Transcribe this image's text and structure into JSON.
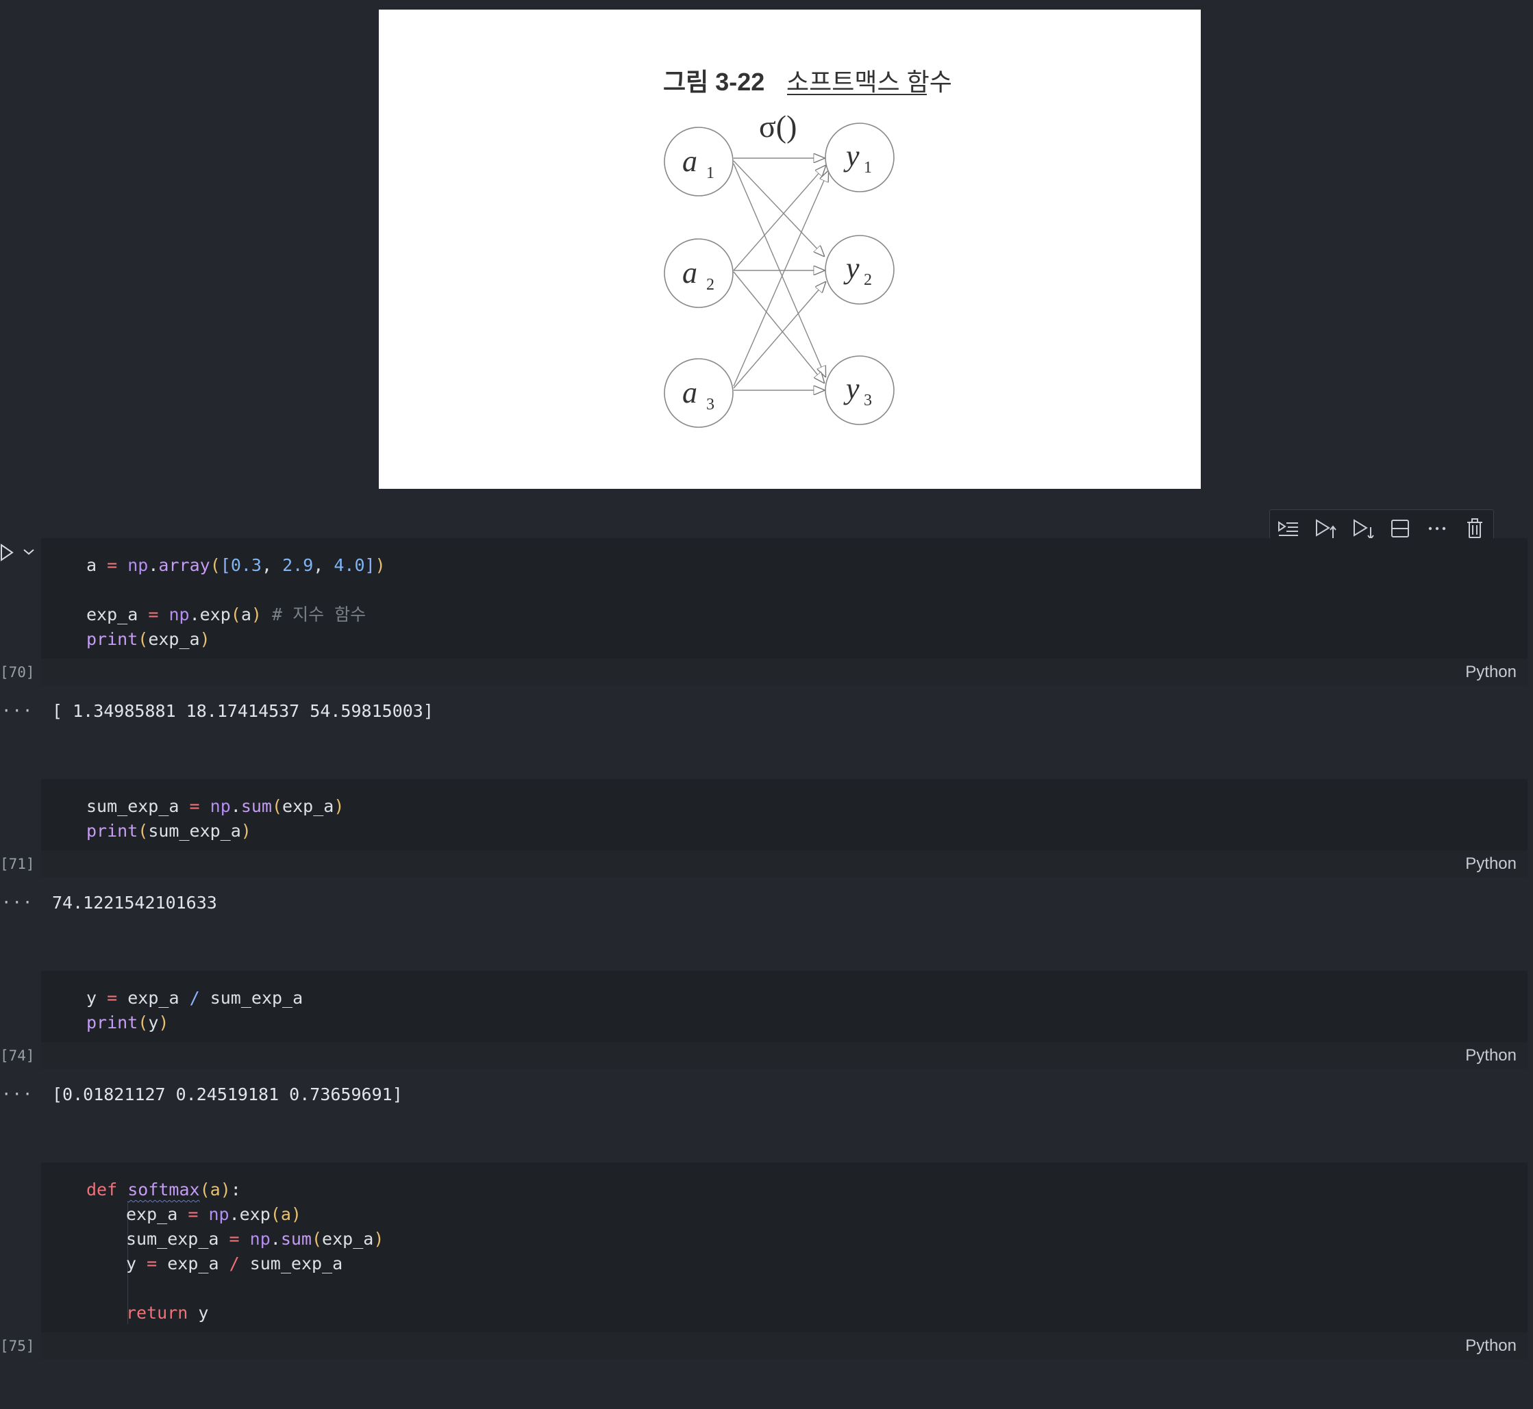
{
  "figure": {
    "title_bold": "그림 3-22",
    "title_rest": "소프트맥스 함수",
    "sigma": "σ()",
    "inputs": [
      "a",
      "a",
      "a"
    ],
    "outputs": [
      "y",
      "y",
      "y"
    ],
    "subscripts": [
      "1",
      "2",
      "3"
    ]
  },
  "toolbar": {
    "icons": [
      "run-by-line-icon",
      "execute-above-icon",
      "execute-below-icon",
      "split-cell-icon",
      "more-icon",
      "delete-icon"
    ]
  },
  "cells": [
    {
      "exec_count": "[70]",
      "language": "Python",
      "output": "[ 1.34985881 18.17414537 54.59815003]"
    },
    {
      "exec_count": "[71]",
      "language": "Python",
      "output": "74.1221542101633"
    },
    {
      "exec_count": "[74]",
      "language": "Python",
      "output": "[0.01821127 0.24519181 0.73659691]"
    },
    {
      "exec_count": "[75]",
      "language": "Python"
    }
  ],
  "code_tokens": {
    "a": "a",
    "eq": "=",
    "np": "np",
    "dot": ".",
    "array": "array",
    "lp": "(",
    "rp": ")",
    "lb": "[",
    "rb": "]",
    "comma": ",",
    "n03": "0.3",
    "n29": "2.9",
    "n40": "4.0",
    "exp_a": "exp_a",
    "exp": "exp",
    "comment1": "# 지수 함수",
    "print": "print",
    "sum_exp_a": "sum_exp_a",
    "sum": "sum",
    "y": "y",
    "slash": "/",
    "def": "def",
    "softmax": "softmax",
    "colon": ":",
    "return": "return"
  },
  "output_marker": "···"
}
